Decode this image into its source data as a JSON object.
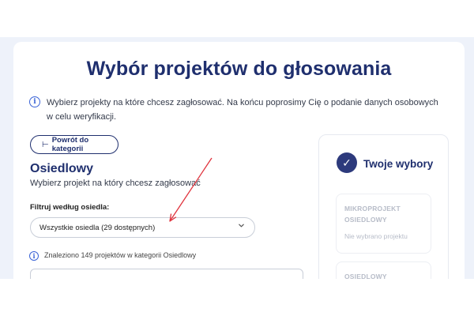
{
  "page": {
    "title": "Wybór projektów do głosowania",
    "info_text": "Wybierz projekty na które chcesz zagłosować. Na końcu poprosimy Cię o podanie danych osobowych w celu weryfikacji."
  },
  "navigation": {
    "back_label": "Powrót do kategorii",
    "back_arrow": "⊢"
  },
  "category": {
    "name": "Osiedlowy",
    "subtitle": "Wybierz projekt na który chcesz zagłosować"
  },
  "filter": {
    "label": "Filtruj według osiedla:",
    "selected": "Wszystkie osiedla (29 dostępnych)"
  },
  "results": {
    "found_text": "Znaleziono 149 projektów w kategorii Osiedlowy"
  },
  "choices": {
    "title": "Twoje wybory",
    "check_glyph": "✓",
    "slots": [
      {
        "label_line1": "MIKROPROJEKT",
        "label_line2": "OSIEDLOWY",
        "empty_text": "Nie wybrano projektu"
      },
      {
        "label_line1": "OSIEDLOWY"
      }
    ]
  },
  "icons": {
    "info": "info-icon",
    "dropdown": "chevron-down-icon"
  },
  "colors": {
    "primary": "#1f2f6e",
    "accent": "#3a63d6",
    "annotation": "#e0323c",
    "background_band": "#eef2fa"
  }
}
